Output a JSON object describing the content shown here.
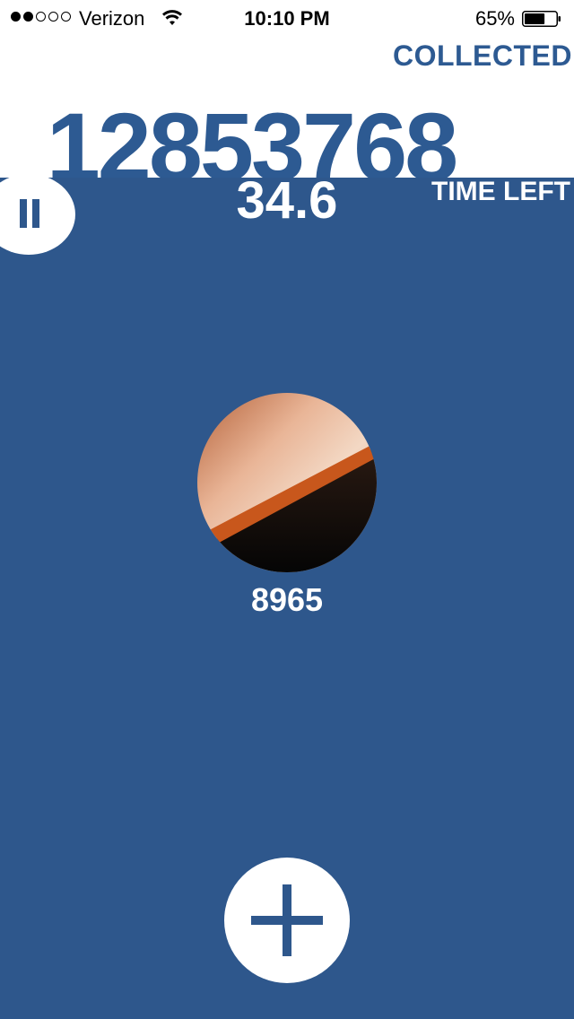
{
  "status_bar": {
    "carrier": "Verizon",
    "signal_bars_filled": 2,
    "signal_bars_total": 5,
    "time": "10:10 PM",
    "battery_percent": "65%",
    "battery_level": 0.65
  },
  "header": {
    "collected_label": "COLLECTED",
    "collected_total": "12853768"
  },
  "timer": {
    "value": "34.6",
    "label": "TIME LEFT"
  },
  "photo": {
    "count": "8965"
  },
  "colors": {
    "primary": "#2e578c",
    "text_blue": "#2d5a92",
    "white": "#ffffff"
  },
  "icons": {
    "pause": "pause-icon",
    "add": "plus-icon",
    "wifi": "wifi-icon",
    "battery": "battery-icon"
  }
}
